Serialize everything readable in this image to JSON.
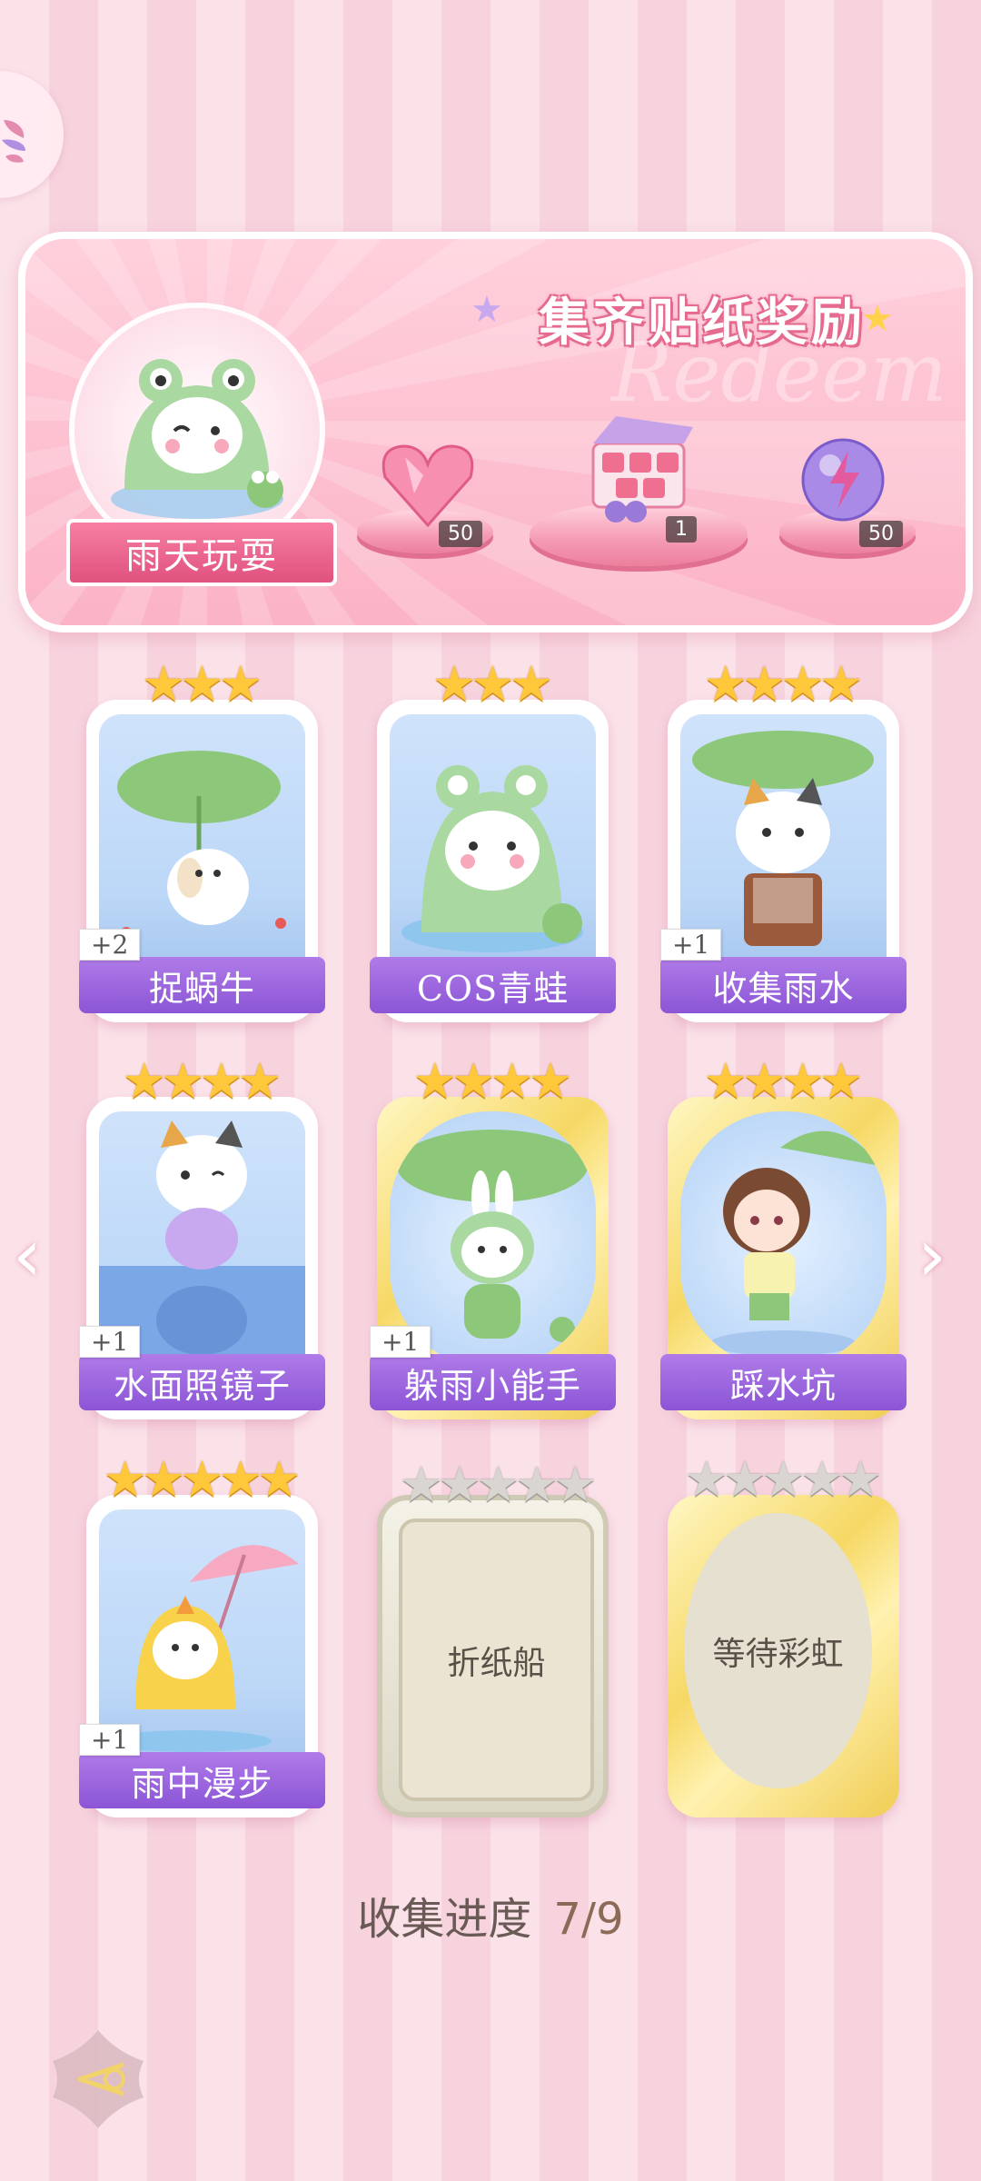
{
  "banner": {
    "title": "集齐贴纸奖励",
    "watermark": "Redeem",
    "avatar_label": "雨天玩耍",
    "rewards": [
      {
        "icon": "heart-gem-icon",
        "count": "50"
      },
      {
        "icon": "gift-box-icon",
        "count": "1"
      },
      {
        "icon": "energy-orb-icon",
        "count": "50"
      }
    ]
  },
  "cards": [
    {
      "label": "捉蜗牛",
      "stars": 3,
      "plus": "+2",
      "frame": "white",
      "art": "puppy-leaf-umbrella"
    },
    {
      "label": "COS青蛙",
      "stars": 3,
      "plus": "",
      "frame": "white",
      "art": "frog-hood-cat"
    },
    {
      "label": "收集雨水",
      "stars": 4,
      "plus": "+1",
      "frame": "white",
      "art": "calico-leaf-umbrella"
    },
    {
      "label": "水面照镜子",
      "stars": 4,
      "plus": "+1",
      "frame": "white",
      "art": "cat-puddle-reflection"
    },
    {
      "label": "躲雨小能手",
      "stars": 4,
      "plus": "+1",
      "frame": "gold",
      "art": "bunny-frog-leaf"
    },
    {
      "label": "踩水坑",
      "stars": 4,
      "plus": "",
      "frame": "gold",
      "art": "girl-frog-umbrella"
    },
    {
      "label": "雨中漫步",
      "stars": 5,
      "plus": "+1",
      "frame": "white",
      "art": "duck-hood-cat-umbrella"
    },
    {
      "label": "折纸船",
      "stars": 5,
      "plus": "",
      "frame": "silver",
      "art": "locked"
    },
    {
      "label": "等待彩虹",
      "stars": 5,
      "plus": "",
      "frame": "gold-locked",
      "art": "locked"
    }
  ],
  "progress": {
    "label": "收集进度",
    "value": "7/9"
  },
  "colors": {
    "accent_pink": "#e0527e",
    "label_purple": "#8b55d6",
    "star_gold": "#ffc83a"
  }
}
